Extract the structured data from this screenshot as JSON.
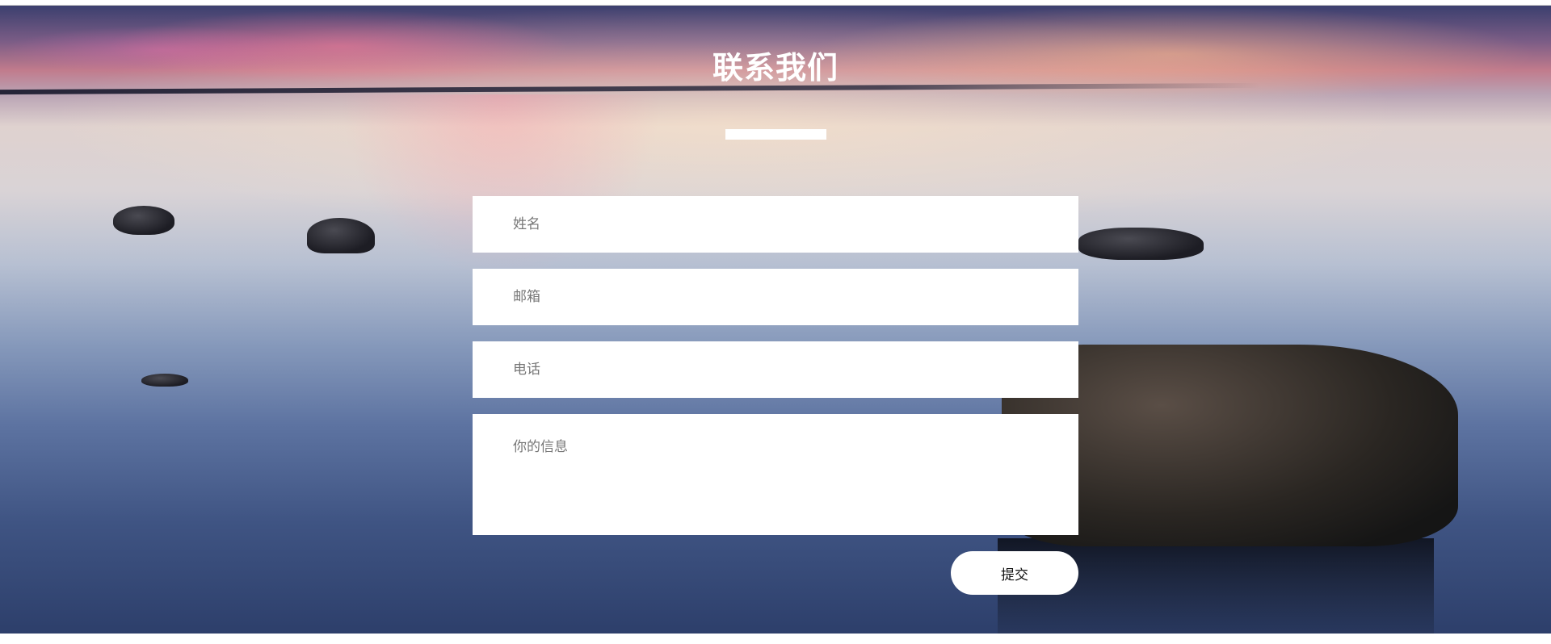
{
  "section": {
    "title": "联系我们"
  },
  "form": {
    "name_placeholder": "姓名",
    "email_placeholder": "邮箱",
    "phone_placeholder": "电话",
    "message_placeholder": "你的信息",
    "submit_label": "提交"
  },
  "colors": {
    "title_text": "#ffffff",
    "field_background": "#ffffff",
    "placeholder_text": "#777777"
  }
}
